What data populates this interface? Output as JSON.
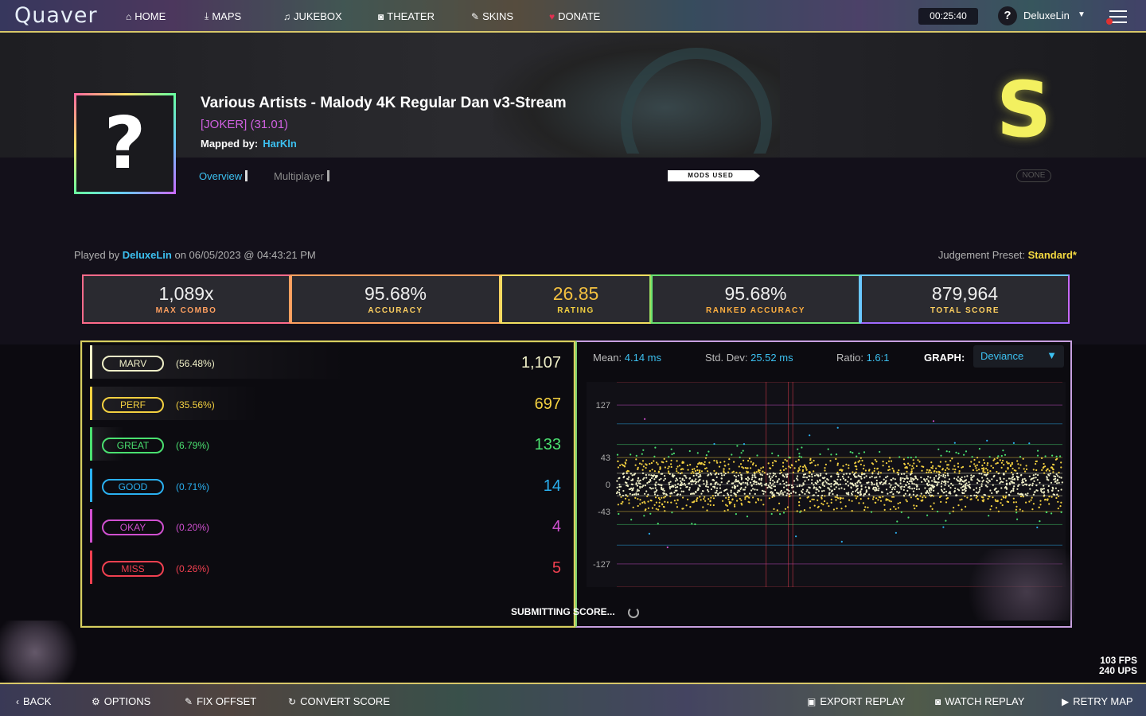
{
  "nav": {
    "logo": "Quaver",
    "items": [
      {
        "label": "HOME",
        "icon": "home-icon",
        "glyph": "⌂"
      },
      {
        "label": "MAPS",
        "icon": "download-icon",
        "glyph": "⤓"
      },
      {
        "label": "JUKEBOX",
        "icon": "music-icon",
        "glyph": "♫"
      },
      {
        "label": "THEATER",
        "icon": "camera-icon",
        "glyph": "◙"
      },
      {
        "label": "SKINS",
        "icon": "brush-icon",
        "glyph": "✎"
      },
      {
        "label": "DONATE",
        "icon": "heart-icon",
        "glyph": "♥"
      }
    ],
    "clock": "00:25:40",
    "user_badge": "?",
    "username": "DeluxeLin"
  },
  "map": {
    "title": "Various Artists - Malody 4K Regular Dan v3-Stream",
    "difficulty": "[JOKER] (31.01)",
    "mapped_by_label": "Mapped by:",
    "mapper": "HarKln",
    "cover_placeholder": "?",
    "grade": "S"
  },
  "tabs": {
    "overview": "Overview",
    "multiplayer": "Multiplayer"
  },
  "mods": {
    "label": "MODS USED",
    "value": "NONE"
  },
  "play": {
    "played_by_label": "Played by",
    "player": "DeluxeLin",
    "on_text": "on 06/05/2023 @ 04:43:21 PM",
    "judgement_label": "Judgement Preset:",
    "judgement_value": "Standard*"
  },
  "stats": [
    {
      "value": "1,089x",
      "label": "MAX COMBO",
      "color": "#ffa060"
    },
    {
      "value": "95.68%",
      "label": "ACCURACY",
      "color": "#ffd060"
    },
    {
      "value": "26.85",
      "label": "RATING",
      "color": "#f3d040"
    },
    {
      "value": "95.68%",
      "label": "RANKED ACCURACY",
      "color": "#ffb040"
    },
    {
      "value": "879,964",
      "label": "TOTAL SCORE",
      "color": "#ffd060"
    }
  ],
  "judgements": [
    {
      "name": "MARV",
      "pct": "(56.48%)",
      "count": "1,107",
      "color": "#f0f0c8",
      "share": 0.5648
    },
    {
      "name": "PERF",
      "pct": "(35.56%)",
      "count": "697",
      "color": "#f3d040",
      "share": 0.3556
    },
    {
      "name": "GREAT",
      "pct": "(6.79%)",
      "count": "133",
      "color": "#4ae070",
      "share": 0.0679
    },
    {
      "name": "GOOD",
      "pct": "(0.71%)",
      "count": "14",
      "color": "#2ab0f0",
      "share": 0.0071
    },
    {
      "name": "OKAY",
      "pct": "(0.20%)",
      "count": "4",
      "color": "#d050d0",
      "share": 0.002
    },
    {
      "name": "MISS",
      "pct": "(0.26%)",
      "count": "5",
      "color": "#f04050",
      "share": 0.0026
    }
  ],
  "graph": {
    "mean_label": "Mean:",
    "mean": "4.14 ms",
    "std_label": "Std. Dev:",
    "std": "25.52 ms",
    "ratio_label": "Ratio:",
    "ratio": "1.6:1",
    "graph_label": "GRAPH:",
    "selected": "Deviance"
  },
  "chart_data": {
    "type": "scatter",
    "title": "",
    "xlabel": "",
    "ylabel": "",
    "ylim": [
      -164,
      164
    ],
    "y_ticks": [
      "127",
      "43",
      "0",
      "-43",
      "-127"
    ],
    "y_tick_values": [
      127,
      43,
      0,
      -43,
      -127
    ],
    "threshold_lines": [
      {
        "value": 164,
        "color": "#f04050"
      },
      {
        "value": 127,
        "color": "#d050d0"
      },
      {
        "value": 97,
        "color": "#2ab0f0"
      },
      {
        "value": 64,
        "color": "#4ae070"
      },
      {
        "value": 43,
        "color": "#f3d040"
      },
      {
        "value": 18,
        "color": "#f0f0c8"
      },
      {
        "value": -18,
        "color": "#f0f0c8"
      },
      {
        "value": -43,
        "color": "#f3d040"
      },
      {
        "value": -64,
        "color": "#4ae070"
      },
      {
        "value": -97,
        "color": "#2ab0f0"
      },
      {
        "value": -127,
        "color": "#d050d0"
      },
      {
        "value": -164,
        "color": "#f04050"
      }
    ],
    "miss_positions": [
      0.335,
      0.385,
      0.395
    ],
    "point_count": 1960
  },
  "status": {
    "submitting": "SUBMITTING SCORE...",
    "fps": "103 FPS",
    "ups": "240 UPS"
  },
  "bottom": {
    "back": "BACK",
    "options": "OPTIONS",
    "fix_offset": "FIX OFFSET",
    "convert": "CONVERT SCORE",
    "export": "EXPORT REPLAY",
    "watch": "WATCH REPLAY",
    "retry": "RETRY MAP"
  }
}
